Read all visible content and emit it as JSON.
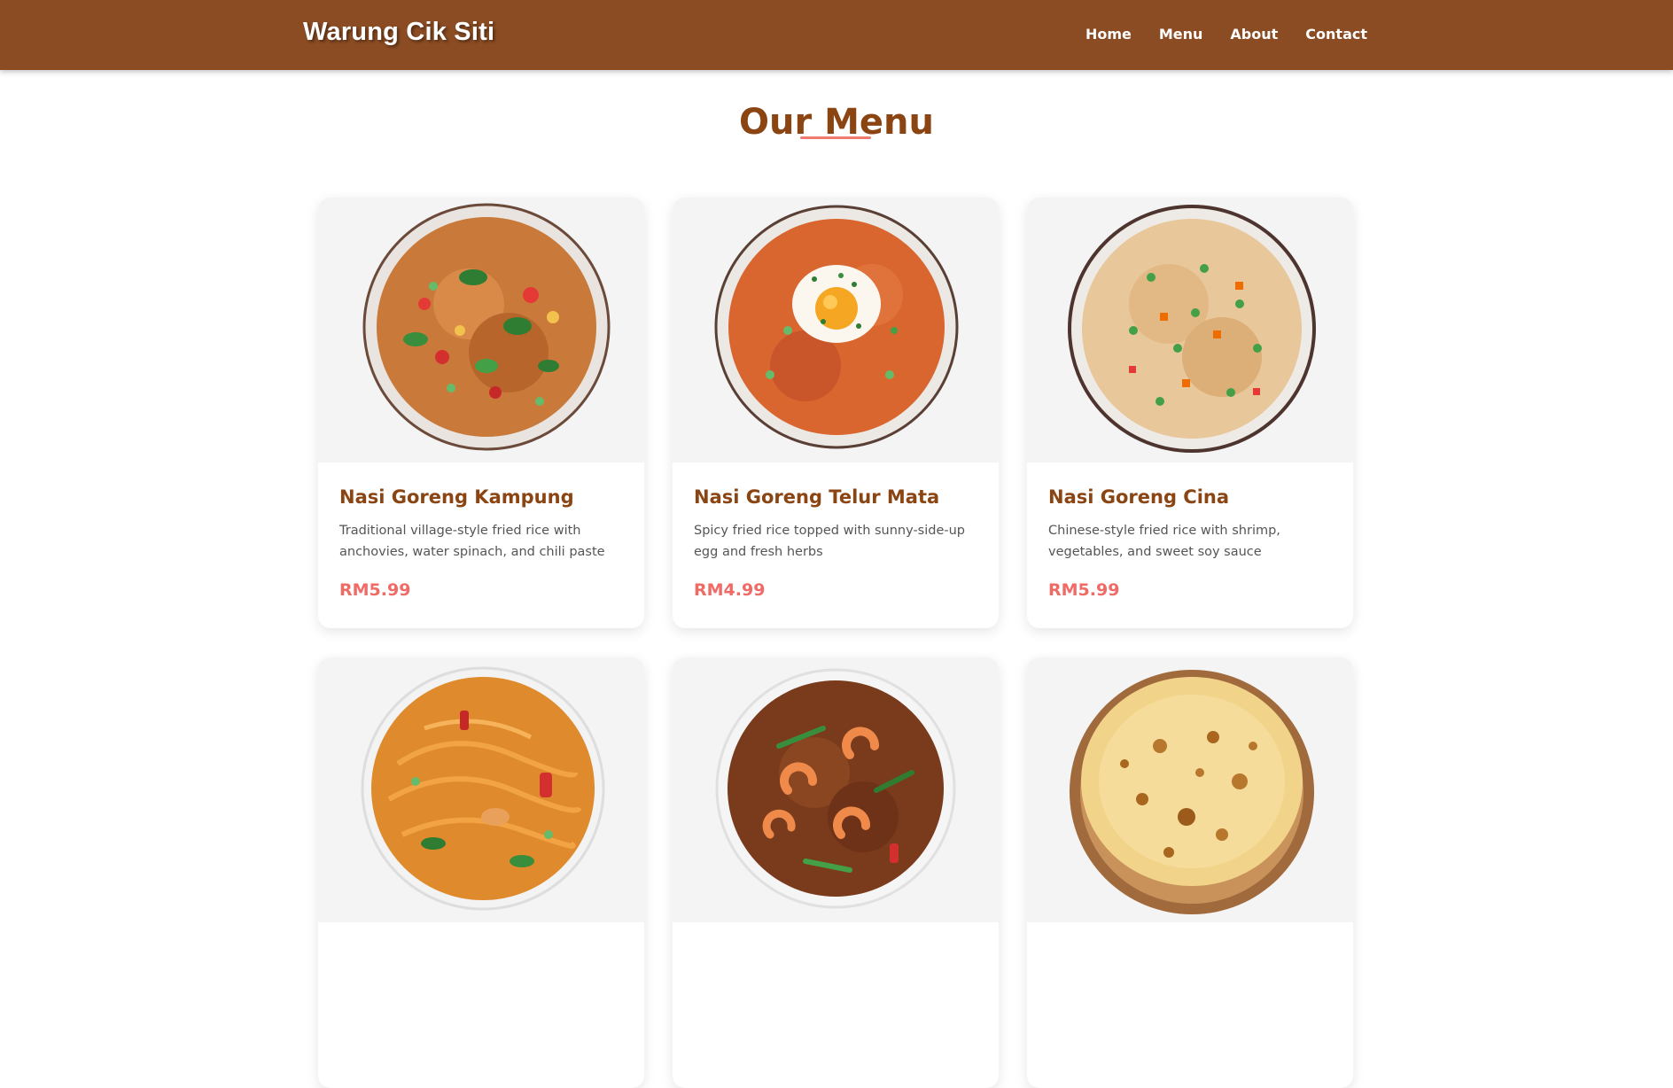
{
  "header": {
    "brand": "Warung Cik Siti",
    "nav": [
      {
        "label": "Home"
      },
      {
        "label": "Menu"
      },
      {
        "label": "About"
      },
      {
        "label": "Contact"
      }
    ]
  },
  "menu": {
    "title": "Our Menu",
    "items": [
      {
        "name": "Nasi Goreng Kampung",
        "description": "Traditional village-style fried rice with anchovies, water spinach, and chili paste",
        "price": "RM5.99",
        "image_icon": "fried-rice-kampung-image"
      },
      {
        "name": "Nasi Goreng Telur Mata",
        "description": "Spicy fried rice topped with sunny-side-up egg and fresh herbs",
        "price": "RM4.99",
        "image_icon": "fried-rice-egg-image"
      },
      {
        "name": "Nasi Goreng Cina",
        "description": "Chinese-style fried rice with shrimp, vegetables, and sweet soy sauce",
        "price": "RM5.99",
        "image_icon": "fried-rice-cina-image"
      },
      {
        "image_icon": "fried-noodles-image"
      },
      {
        "image_icon": "shrimp-noodles-image"
      },
      {
        "image_icon": "roti-canai-image"
      }
    ]
  },
  "colors": {
    "navbar": "#8B4C23",
    "title": "#8B4513",
    "accent": "#f07a6e",
    "price": "#f06a66"
  }
}
